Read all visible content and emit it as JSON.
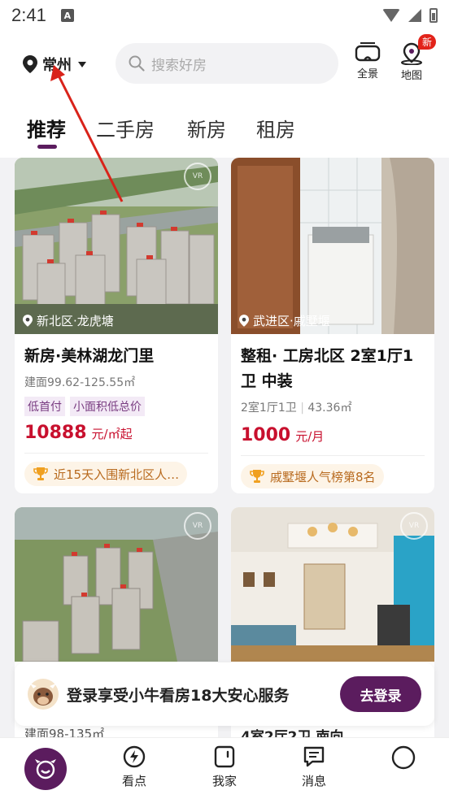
{
  "status_bar": {
    "time": "2:41",
    "notification": "A"
  },
  "header": {
    "city": "常州",
    "search_placeholder": "搜索好房",
    "panorama_label": "全景",
    "map_label": "地图",
    "new_badge": "新"
  },
  "tabs": [
    {
      "label": "推荐",
      "active": true
    },
    {
      "label": "二手房",
      "active": false
    },
    {
      "label": "新房",
      "active": false
    },
    {
      "label": "租房",
      "active": false
    }
  ],
  "cards": [
    {
      "location": "新北区·龙虎塘",
      "title": "新房·美林湖龙门里",
      "subtitle": "建面99.62-125.55㎡",
      "tags": [
        "低首付",
        "小面积低总价"
      ],
      "price": "10888",
      "price_unit": "元/㎡起",
      "rank": "近15天入围新北区人…"
    },
    {
      "location": "武进区·戚墅堰",
      "title": "整租· 工房北区 2室1厅1卫 中装",
      "subtitle_rooms": "2室1厅1卫",
      "subtitle_area": "43.36㎡",
      "price": "1000",
      "price_unit": "元/月",
      "rank": "戚墅堰人气榜第8名"
    },
    {
      "peek_text": "建面98-135㎡"
    },
    {
      "peek_text": "4室2厅2卫 南向"
    }
  ],
  "login_banner": {
    "text": "登录享受小牛看房18大安心服务",
    "button": "去登录"
  },
  "bottom_nav": [
    {
      "label": "",
      "icon": "home-icon"
    },
    {
      "label": "看点",
      "icon": "lightning-icon"
    },
    {
      "label": "我家",
      "icon": "phone-icon"
    },
    {
      "label": "消息",
      "icon": "message-icon"
    },
    {
      "label": "",
      "icon": "profile-icon"
    }
  ],
  "colors": {
    "brand": "#5b1c5e",
    "price": "#c8102e",
    "rank_text": "#b86a1e",
    "arrow": "#d9231a"
  }
}
